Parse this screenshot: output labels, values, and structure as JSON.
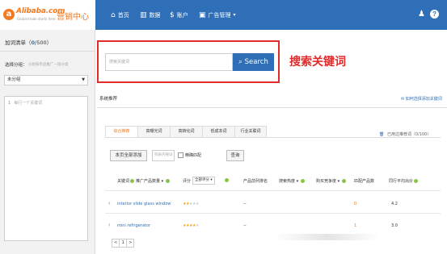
{
  "logo": {
    "brand": "Alibaba.com",
    "tagline": "Global trade starts here",
    "center_name": "营销中心"
  },
  "nav": {
    "items": [
      {
        "label": "首页",
        "icon": "home-icon",
        "glyph": "⌂"
      },
      {
        "label": "数据",
        "icon": "bar-chart-icon",
        "glyph": "▥"
      },
      {
        "label": "账户",
        "icon": "account-icon",
        "glyph": "$"
      },
      {
        "label": "广告管理",
        "icon": "briefcase-icon",
        "glyph": "▣"
      }
    ],
    "dropdown_caret": "▾",
    "bell_glyph": "♟",
    "help_glyph": "?"
  },
  "sidebar": {
    "title_prefix": "加词清单（",
    "count": "0",
    "title_suffix": "/500）",
    "group_label": "选择分组：",
    "group_hint": "分组按单品推广一级分类",
    "group_select": "未分组",
    "textarea_line_number": "1",
    "textarea_placeholder": "每行一个关键词"
  },
  "search": {
    "placeholder": "搜索关键词",
    "button_label": "Search",
    "button_icon": "search-icon",
    "annotation": "搜索关键词"
  },
  "section": {
    "tab_label": "系统推荐",
    "howto_link": "如何选择添加关键词"
  },
  "subtabs": [
    {
      "label": "综合推荐",
      "active": true
    },
    {
      "label": "高曝光词",
      "active": false
    },
    {
      "label": "高转化词",
      "active": false
    },
    {
      "label": "低成本词",
      "active": false
    },
    {
      "label": "行业关联词",
      "active": false
    }
  ],
  "recent": {
    "label": "已用过推荐词（0/100）",
    "icon": "trash-icon"
  },
  "actions": {
    "add_all": "本页全部添加",
    "filter_placeholder": "列表内搜词",
    "fuzzy_label": "精确匹配",
    "query": "查询"
  },
  "table": {
    "headers": {
      "keyword": "关键词",
      "products": "推广产品数量",
      "rating": "评分",
      "rating_select": "全部评分",
      "rank": "产品前列排名",
      "heat": "搜索热度",
      "competition": "购买竞争度",
      "matched": "匹配产品数",
      "avg_price": "同行平均出价"
    },
    "rows": [
      {
        "keyword": "interior slide glass window",
        "rating_stars": 2,
        "rank": "--",
        "heat": "",
        "competition": "",
        "matched": "0",
        "avg_price": "4.2"
      },
      {
        "keyword": "mini refrigerator",
        "rating_stars": 4,
        "rank": "--",
        "heat": "",
        "competition": "",
        "matched": "1",
        "avg_price": "3.0"
      }
    ],
    "max_stars": 5
  },
  "pager": {
    "prev": "<",
    "current": "1",
    "next": ">"
  }
}
